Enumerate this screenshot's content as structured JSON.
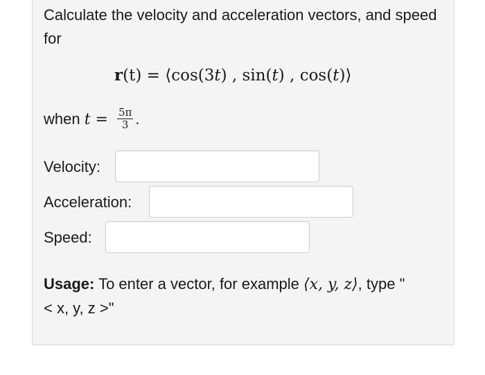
{
  "question": {
    "intro": "Calculate the velocity and acceleration vectors, and speed for",
    "equation": {
      "func": "r",
      "arg": "(t)",
      "equals": "=",
      "open": "⟨",
      "c1_fn": "cos",
      "c1_arg_open": "(3",
      "c1_arg_var": "t",
      "c1_arg_close": ")",
      "sep1": " , ",
      "c2_fn": "sin",
      "c2_arg_open": "(",
      "c2_arg_var": "t",
      "c2_arg_close": ")",
      "sep2": " , ",
      "c3_fn": "cos",
      "c3_arg_open": "(",
      "c3_arg_var": "t",
      "c3_arg_close": ")",
      "close": "⟩"
    },
    "when": {
      "prefix": "when ",
      "var": "t",
      "equals": " = ",
      "numerator": "5π",
      "denominator": "3",
      "suffix": "."
    }
  },
  "answers": {
    "velocity": {
      "label": "Velocity:",
      "value": ""
    },
    "acceleration": {
      "label": "Acceleration:",
      "value": ""
    },
    "speed": {
      "label": "Speed:",
      "value": ""
    }
  },
  "usage": {
    "bold": "Usage:",
    "text1": " To enter a vector, for example ",
    "example": "⟨x, y, z⟩",
    "text2": ", type \"",
    "format": "< x, y, z >",
    "text3": "\""
  }
}
